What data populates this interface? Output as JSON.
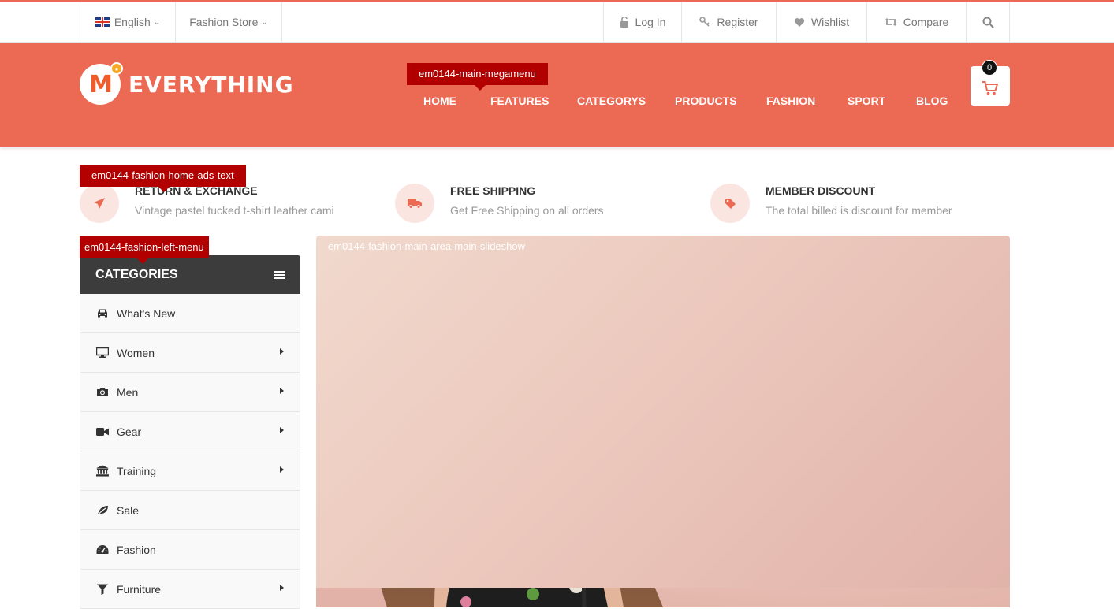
{
  "topbar": {
    "language": "English",
    "store": "Fashion Store",
    "login": "Log In",
    "register": "Register",
    "wishlist": "Wishlist",
    "compare": "Compare"
  },
  "header": {
    "logo_mark": "M",
    "logo_text": "EVERYTHING",
    "nav": [
      "HOME",
      "FEATURES",
      "CATEGORYS",
      "PRODUCTS",
      "FASHION",
      "SPORT",
      "BLOG"
    ],
    "cart_count": "0"
  },
  "tags": {
    "megamenu": "em0144-main-megamenu",
    "ads": "em0144-fashion-home-ads-text",
    "left_menu": "em0144-fashion-left-menu",
    "slideshow": "em0144-fashion-main-area-main-slideshow"
  },
  "features": [
    {
      "title": "RETURN & EXCHANGE",
      "desc": "Vintage pastel tucked t-shirt leather cami",
      "icon": "paper-plane-icon"
    },
    {
      "title": "FREE SHIPPING",
      "desc": "Get Free Shipping on all orders",
      "icon": "truck-icon"
    },
    {
      "title": "MEMBER DISCOUNT",
      "desc": "The total billed is discount for member",
      "icon": "tag-icon"
    }
  ],
  "categories": {
    "title": "CATEGORIES",
    "items": [
      {
        "label": "What's New",
        "icon": "car-icon",
        "has_sub": false
      },
      {
        "label": "Women",
        "icon": "monitor-icon",
        "has_sub": true
      },
      {
        "label": "Men",
        "icon": "camera-icon",
        "has_sub": true
      },
      {
        "label": "Gear",
        "icon": "video-camera-icon",
        "has_sub": true
      },
      {
        "label": "Training",
        "icon": "bank-icon",
        "has_sub": true
      },
      {
        "label": "Sale",
        "icon": "leaf-icon",
        "has_sub": false
      },
      {
        "label": "Fashion",
        "icon": "dashboard-icon",
        "has_sub": false
      },
      {
        "label": "Furniture",
        "icon": "filter-icon",
        "has_sub": true
      }
    ]
  },
  "colors": {
    "brand": "#ec6a53",
    "tag_red": "#b20000",
    "dark": "#3c3c3c"
  }
}
